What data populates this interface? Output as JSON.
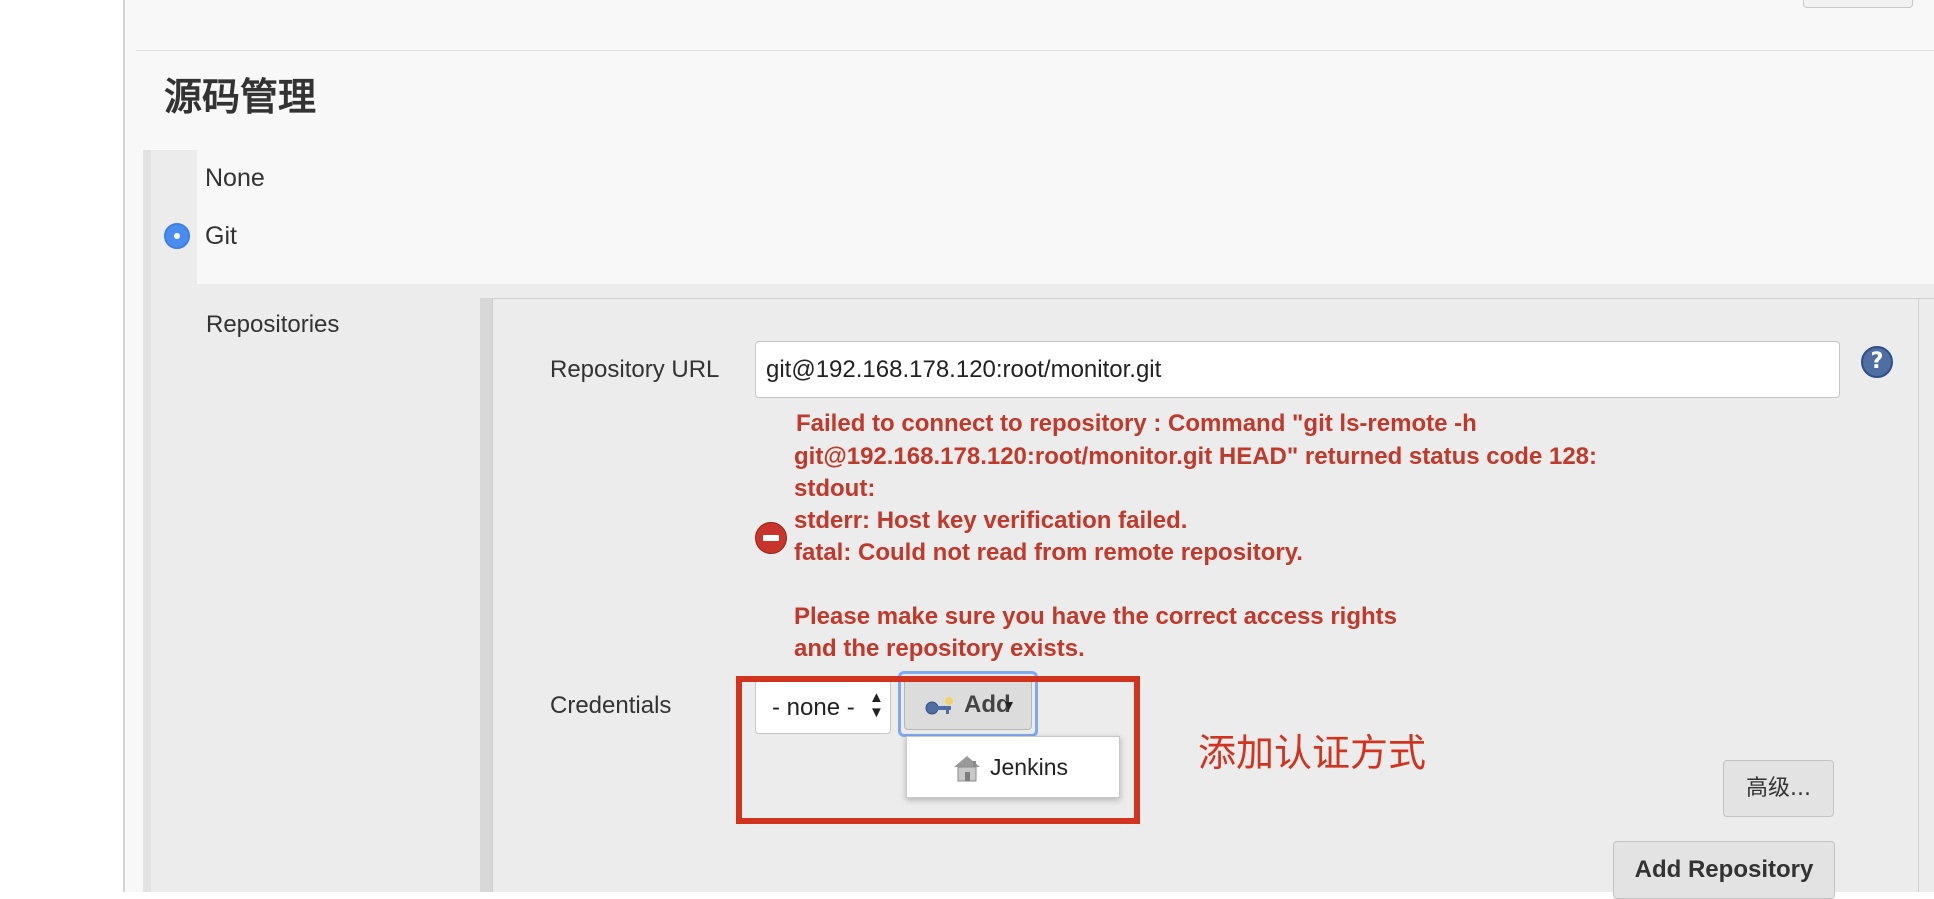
{
  "section": {
    "title": "源码管理"
  },
  "scm_options": [
    {
      "label": "None",
      "selected": false
    },
    {
      "label": "Git",
      "selected": true
    }
  ],
  "repositories": {
    "label": "Repositories",
    "url_label": "Repository URL",
    "url_value": "git@192.168.178.120:root/monitor.git",
    "help_glyph": "?",
    "error_lines": [
      "Failed to connect to repository : Command \"git ls-remote -h",
      "git@192.168.178.120:root/monitor.git HEAD\" returned status code 128:",
      "stdout:",
      "stderr: Host key verification failed.",
      "fatal: Could not read from remote repository.",
      "",
      "Please make sure you have the correct access rights",
      "and the repository exists."
    ],
    "credentials_label": "Credentials",
    "credentials_selected": "- none -",
    "add_button": "Add",
    "dropdown_item": "Jenkins",
    "advanced_button": "高级...",
    "add_repository_button": "Add Repository"
  },
  "annotation": "添加认证方式",
  "colors": {
    "error": "#c0392b",
    "annotation": "#d0341f",
    "radio_selected": "#4a8df0"
  },
  "icons": [
    "help-icon",
    "error-icon",
    "key-icon",
    "caret-down-icon",
    "jenkins-icon",
    "select-arrows-icon"
  ]
}
